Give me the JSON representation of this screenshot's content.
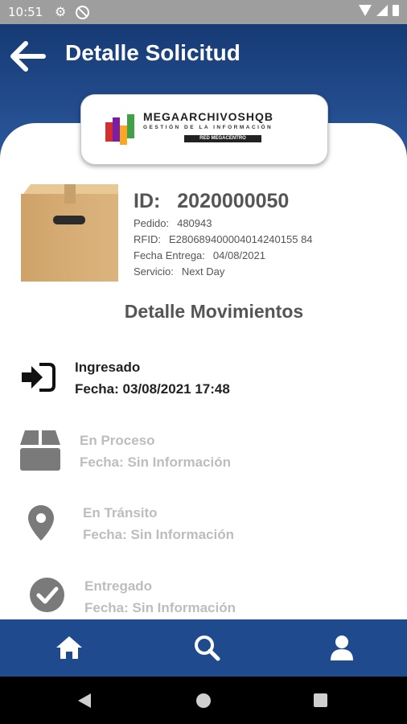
{
  "status_bar": {
    "time": "10:51"
  },
  "header": {
    "title": "Detalle Solicitud"
  },
  "logo": {
    "brand": "MEGAARCHIVOSHQB",
    "tagline": "GESTIÓN DE LA INFORMACIÓN",
    "network": "RED MEGACENTRO"
  },
  "detail": {
    "id_label": "ID:",
    "id_value": "2020000050",
    "fields": [
      {
        "label": "Pedido:",
        "value": "480943"
      },
      {
        "label": "RFID:",
        "value": "E280689400004014240155 84"
      },
      {
        "label": "Fecha Entrega:",
        "value": "04/08/2021"
      },
      {
        "label": "Servicio:",
        "value": "Next Day"
      }
    ]
  },
  "movements": {
    "title": "Detalle Movimientos",
    "items": [
      {
        "status": "Ingresado",
        "date": "Fecha: 03/08/2021 17:48",
        "icon": "sign-in-icon",
        "active": true
      },
      {
        "status": "En Proceso",
        "date": "Fecha: Sin Información",
        "icon": "box-icon",
        "active": false
      },
      {
        "status": "En Tránsito",
        "date": "Fecha: Sin Información",
        "icon": "map-pin-icon",
        "active": false
      },
      {
        "status": "Entregado",
        "date": "Fecha: Sin Información",
        "icon": "check-circle-icon",
        "active": false
      }
    ]
  },
  "bottom_nav": {
    "items": [
      "home-icon",
      "search-icon",
      "user-icon"
    ]
  },
  "colors": {
    "header": "#163a74",
    "nav": "#1f4b8e",
    "active_text": "#222222",
    "inactive_text": "#bdbdbd"
  }
}
